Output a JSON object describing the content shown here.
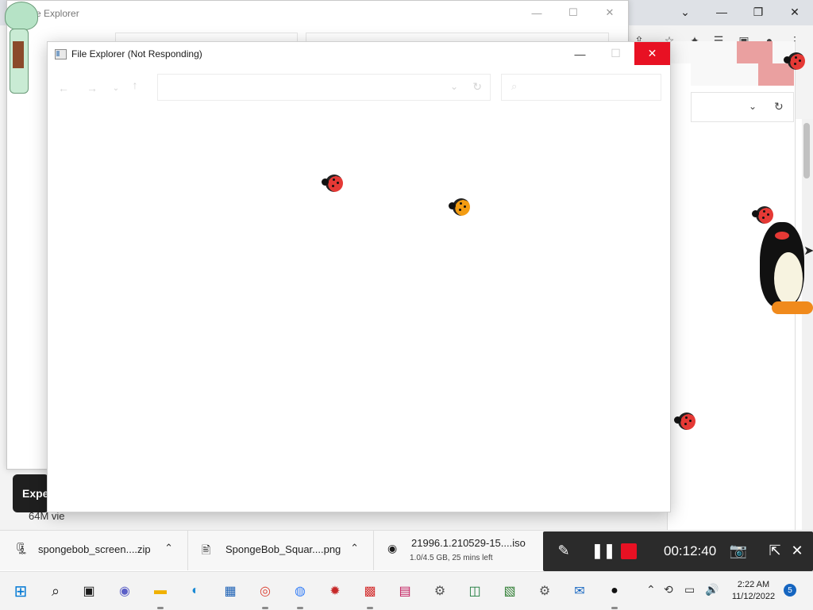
{
  "browser": {
    "controls": [
      "⌄",
      "—",
      "❐",
      "✕"
    ]
  },
  "explorer_back": {
    "title": "e Explorer"
  },
  "main_window": {
    "title": "File Explorer (Not Responding)",
    "minimize": "—",
    "maximize": "☐",
    "close": "✕"
  },
  "background": {
    "pill_text": "Exper",
    "snippet": "64M vie"
  },
  "downloads": [
    {
      "name": "spongebob_screen....zip",
      "sub": "",
      "icon": "zip-icon"
    },
    {
      "name": "SpongeBob_Squar....png",
      "sub": "",
      "icon": "png-file-icon"
    },
    {
      "name": "21996.1.210529-15....iso",
      "sub": "1.0/4.5 GB, 25 mins left",
      "icon": "iso-file-icon"
    }
  ],
  "recorder": {
    "time": "00:12:40"
  },
  "taskbar": {
    "clock_time": "2:22 AM",
    "clock_date": "11/12/2022",
    "notification_count": "5"
  },
  "colors": {
    "close_red": "#e81123",
    "record_red": "#e81123",
    "taskbar_bg": "#f3f3f3"
  }
}
